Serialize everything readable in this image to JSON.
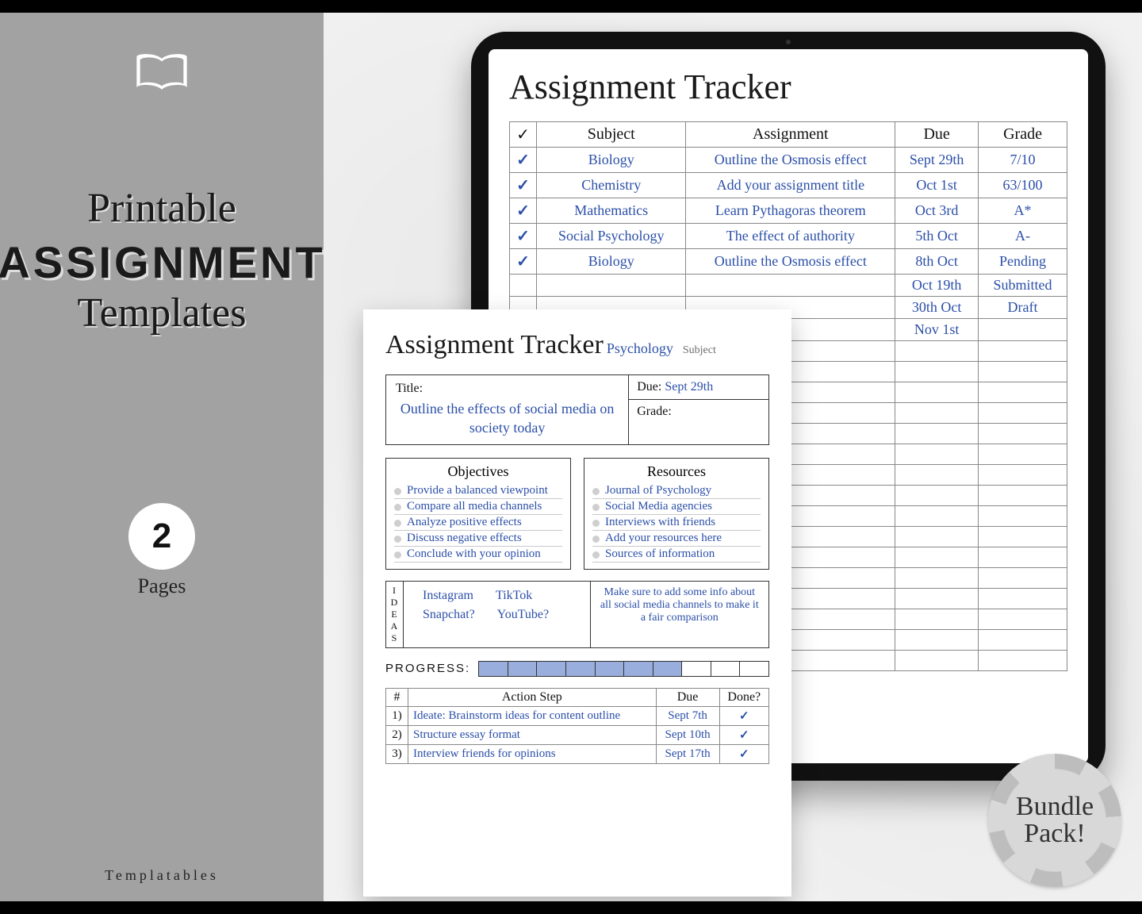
{
  "left": {
    "line1": "Printable",
    "line2": "ASSIGNMENT",
    "line3": "Templates",
    "pages_count": "2",
    "pages_label": "Pages",
    "brand": "Templatables"
  },
  "tablet": {
    "title": "Assignment Tracker",
    "headers": {
      "check": "✓",
      "subject": "Subject",
      "assignment": "Assignment",
      "due": "Due",
      "grade": "Grade"
    },
    "rows": [
      {
        "subject": "Biology",
        "assignment": "Outline the Osmosis effect",
        "due": "Sept 29th",
        "grade": "7/10"
      },
      {
        "subject": "Chemistry",
        "assignment": "Add your assignment title",
        "due": "Oct 1st",
        "grade": "63/100"
      },
      {
        "subject": "Mathematics",
        "assignment": "Learn Pythagoras theorem",
        "due": "Oct 3rd",
        "grade": "A*"
      },
      {
        "subject": "Social Psychology",
        "assignment": "The effect of authority",
        "due": "5th Oct",
        "grade": "A-"
      },
      {
        "subject": "Biology",
        "assignment": "Outline the Osmosis effect",
        "due": "8th Oct",
        "grade": "Pending"
      },
      {
        "subject": "",
        "assignment": "",
        "due": "Oct 19th",
        "grade": "Submitted"
      },
      {
        "subject": "",
        "assignment": "",
        "due": "30th Oct",
        "grade": "Draft"
      },
      {
        "subject": "",
        "assignment": "",
        "due": "Nov 1st",
        "grade": ""
      }
    ]
  },
  "paper": {
    "title": "Assignment Tracker",
    "subject_value": "Psychology",
    "subject_label": "Subject",
    "title_label": "Title:",
    "title_value": "Outline the effects of social media on society today",
    "due_label": "Due:",
    "due_value": "Sept 29th",
    "grade_label": "Grade:",
    "objectives_h": "Objectives",
    "objectives": [
      "Provide a balanced viewpoint",
      "Compare all media channels",
      "Analyze positive effects",
      "Discuss negative effects",
      "Conclude with your opinion"
    ],
    "resources_h": "Resources",
    "resources": [
      "Journal of Psychology",
      "Social Media agencies",
      "Interviews with friends",
      "Add your resources here",
      "Sources of information"
    ],
    "ideas_label": "IDEAS",
    "ideas_left": [
      "Instagram",
      "TikTok",
      "Snapchat?",
      "YouTube?"
    ],
    "ideas_right": "Make sure to add some info about all social media channels to make it a fair comparison",
    "progress_label": "PROGRESS:",
    "progress_fill": 7,
    "progress_total": 10,
    "action_headers": {
      "num": "#",
      "step": "Action Step",
      "due": "Due",
      "done": "Done?"
    },
    "actions": [
      {
        "n": "1)",
        "step": "Ideate: Brainstorm ideas for content outline",
        "due": "Sept 7th",
        "done": true
      },
      {
        "n": "2)",
        "step": "Structure essay format",
        "due": "Sept 10th",
        "done": true
      },
      {
        "n": "3)",
        "step": "Interview friends for opinions",
        "due": "Sept 17th",
        "done": true
      }
    ]
  },
  "bundle": {
    "line1": "Bundle",
    "line2": "Pack!"
  }
}
